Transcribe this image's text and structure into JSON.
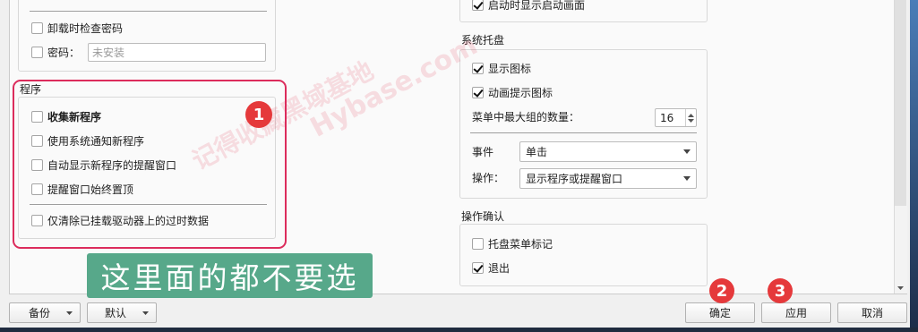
{
  "left": {
    "security": {
      "uninstall_check_password": {
        "label": "卸载时检查密码",
        "checked": false
      },
      "password": {
        "label": "密码：",
        "checked": false,
        "placeholder": "未安装"
      }
    },
    "programs": {
      "title": "程序",
      "collect_new": {
        "label": "收集新程序",
        "checked": false
      },
      "system_notify": {
        "label": "使用系统通知新程序",
        "checked": false
      },
      "auto_show_reminder": {
        "label": "自动显示新程序的提醒窗口",
        "checked": false
      },
      "reminder_topmost": {
        "label": "提醒窗口始终置顶",
        "checked": false
      },
      "clear_mounted_only": {
        "label": "仅清除已挂载驱动器上的过时数据",
        "checked": false
      }
    }
  },
  "right": {
    "startup": {
      "show_splash": {
        "label": "启动时显示启动画面",
        "checked": true
      }
    },
    "tray": {
      "title": "系统托盘",
      "show_icon": {
        "label": "显示图标",
        "checked": true
      },
      "animate_icon": {
        "label": "动画提示图标",
        "checked": true
      },
      "max_groups": {
        "label": "菜单中最大组的数量：",
        "value": "16"
      },
      "event": {
        "label": "事件",
        "value": "单击"
      },
      "action": {
        "label": "操作：",
        "value": "显示程序或提醒窗口"
      }
    },
    "confirm": {
      "title": "操作确认",
      "tray_menu_mark": {
        "label": "托盘菜单标记",
        "checked": false
      },
      "exit": {
        "label": "退出",
        "checked": true
      }
    }
  },
  "footer": {
    "backup": "备份",
    "default": "默认",
    "ok": "确定",
    "apply": "应用",
    "cancel": "取消"
  },
  "annotations": {
    "step1": "1",
    "step2": "2",
    "step3": "3",
    "note": "这里面的都不要选"
  },
  "watermark": {
    "cn": "记得收藏黑域基地",
    "en": "Hybase.com"
  },
  "colors": {
    "annotation_red": "#e5393b",
    "annotation_box": "#dc2c5c",
    "note_green": "#57a88a"
  }
}
